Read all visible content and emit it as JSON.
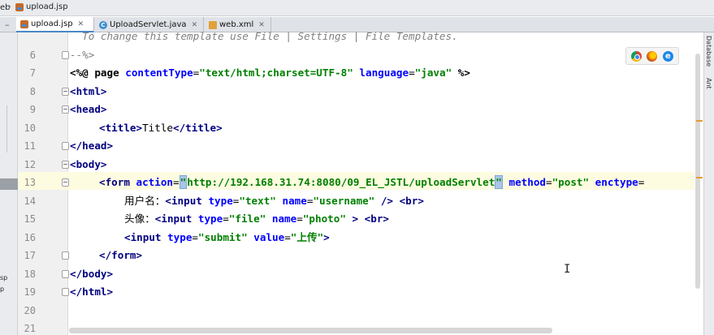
{
  "breadcrumb": {
    "left": "eb",
    "file": "upload.jsp"
  },
  "tabs": [
    {
      "label": "upload.jsp",
      "active": true
    },
    {
      "label": "UploadServlet.java",
      "active": false
    },
    {
      "label": "web.xml",
      "active": false
    }
  ],
  "left_strip": {
    "item1": "sp",
    "item2": "p"
  },
  "right_strip": {
    "database": "Database",
    "ant": "Ant"
  },
  "editor": {
    "line_numbers": [
      "6",
      "7",
      "8",
      "9",
      "10",
      "11",
      "12",
      "13",
      "14",
      "15",
      "16",
      "17",
      "18",
      "19",
      "20",
      "21"
    ],
    "line6": "  To change this template use File | Settings | File Templates.",
    "line7": "--%>",
    "line8": {
      "open": "<%@ page ",
      "a1": "contentType",
      "v1": "\"text/html;charset=UTF-8\"",
      "a2": "language",
      "v2": "\"java\"",
      "close": " %>"
    },
    "line9": "<html>",
    "line10": "<head>",
    "line11": {
      "open": "<title>",
      "text": "Title",
      "close": "</title>"
    },
    "line12": "</head>",
    "line13": "<body>",
    "line14": {
      "open": "<form ",
      "a1": "action",
      "eq": "=",
      "q1": "\"",
      "url": "http://192.168.31.74:8080/09_EL_JSTL/uploadServlet",
      "q2": "\"",
      "a2": "method",
      "v2": "\"post\"",
      "a3": "enctype",
      "tail": "="
    },
    "line15": {
      "label": "用户名：",
      "open": "<input ",
      "a1": "type",
      "v1": "\"text\"",
      "a2": "name",
      "v2": "\"username\"",
      "close": " />",
      "br": "<br>"
    },
    "line16": {
      "label": "头像：",
      "open": "<input ",
      "a1": "type",
      "v1": "\"file\"",
      "a2": "name",
      "v2": "\"photo\"",
      "close": " >",
      "br": "<br>"
    },
    "line17": {
      "open": "<input ",
      "a1": "type",
      "v1": "\"submit\"",
      "a2": "value",
      "v2": "\"上传\"",
      "close": ">"
    },
    "line18": "</form>",
    "line19": "</body>",
    "line20": "</html>",
    "line21": ""
  },
  "browser_icons": [
    "chrome-icon",
    "firefox-icon",
    "ie-icon"
  ],
  "colors": {
    "tag": "#000080",
    "attr": "#0000ff",
    "string": "#008000",
    "comment": "#808080",
    "current_line": "#fdfbe0"
  }
}
